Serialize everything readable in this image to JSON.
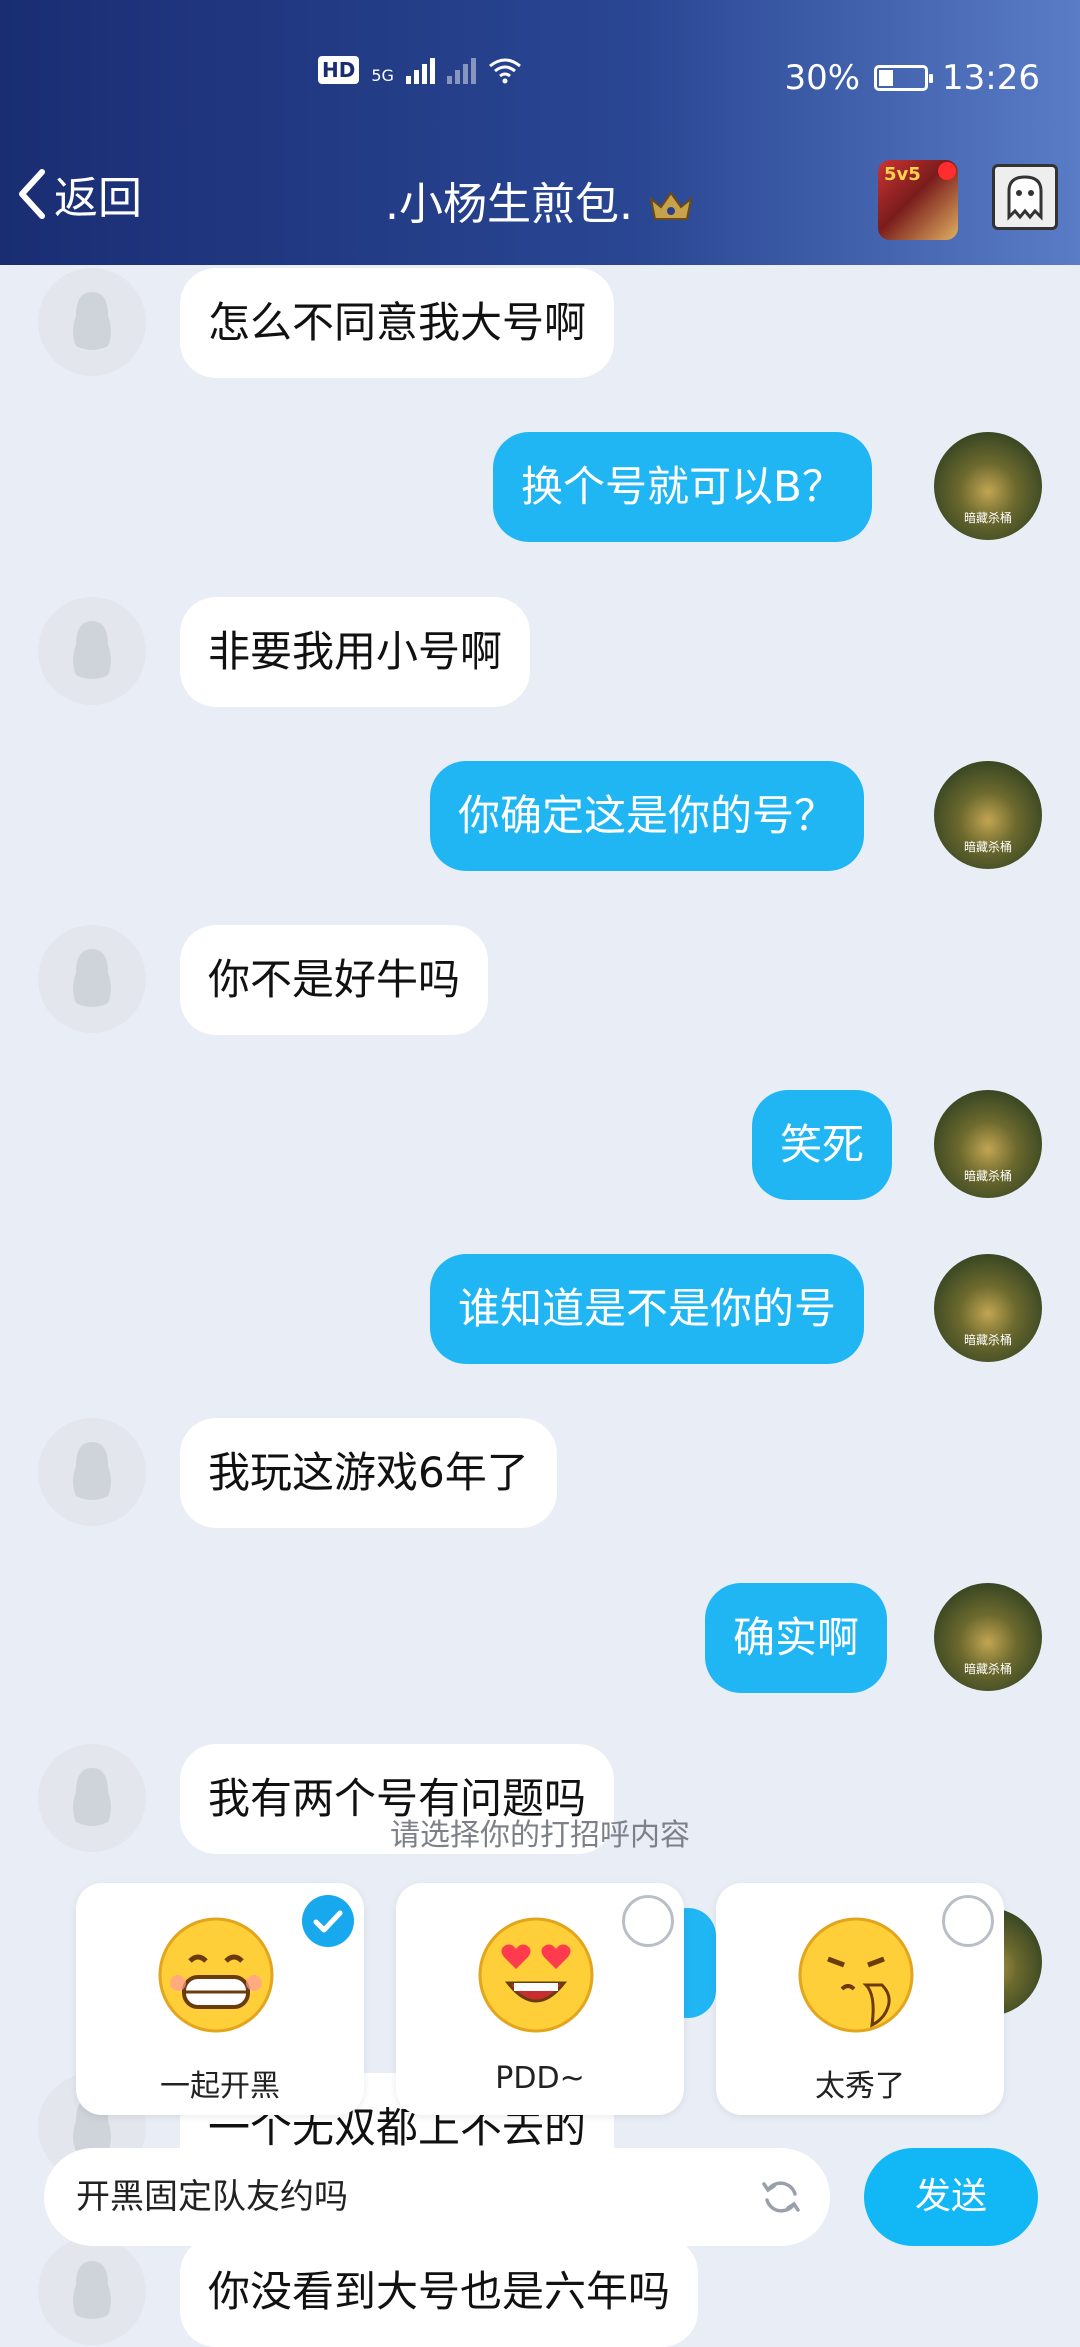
{
  "status_bar": {
    "network_badge": "HD",
    "net_type": "5G",
    "battery": "30%",
    "time": "13:26"
  },
  "nav": {
    "back_label": "返回",
    "title": ".小杨生煎包.",
    "game_icon_text": "5v5"
  },
  "messages": [
    {
      "side": "in",
      "text": "怎么不同意我大号啊"
    },
    {
      "side": "out",
      "text": "换个号就可以B？"
    },
    {
      "side": "in",
      "text": "非要我用小号啊"
    },
    {
      "side": "out",
      "text": "你确定这是你的号？"
    },
    {
      "side": "in",
      "text": "你不是好牛吗"
    },
    {
      "side": "out",
      "text": "笑死"
    },
    {
      "side": "out",
      "text": "谁知道是不是你的号"
    },
    {
      "side": "in",
      "text": "我玩这游戏6年了"
    },
    {
      "side": "out",
      "text": "确实啊"
    },
    {
      "side": "in",
      "text": "我有两个号有问题吗"
    },
    {
      "side": "in",
      "text": "一个无双都上不去的"
    },
    {
      "side": "in",
      "text": "你没看到大号也是六年吗"
    }
  ],
  "avatar_caption": "暗藏杀桶",
  "greeting": {
    "prompt": "请选择你的打招呼内容",
    "options": [
      {
        "label": "一起开黑",
        "selected": true,
        "emoji": "grin-face"
      },
      {
        "label": "PDD~",
        "selected": false,
        "emoji": "heart-eyes-face"
      },
      {
        "label": "太秀了",
        "selected": false,
        "emoji": "praying-face"
      }
    ]
  },
  "input": {
    "value": "开黑固定队友约吗",
    "send_label": "发送"
  },
  "colors": {
    "outgoing_bubble": "#20b6f4",
    "header": "#1a2d73",
    "background": "#e9edf5"
  }
}
